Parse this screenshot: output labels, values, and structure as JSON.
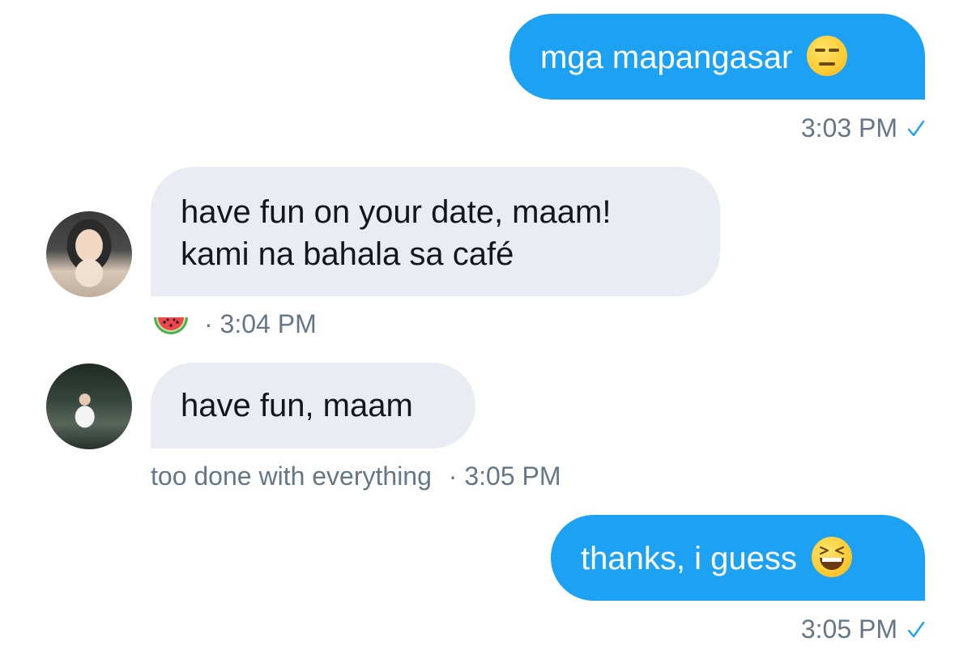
{
  "messages": [
    {
      "direction": "sent",
      "text": "mga mapangasar",
      "emoji": "expressionless-face-emoji",
      "time": "3:03 PM",
      "read_status": "check-icon"
    },
    {
      "direction": "received",
      "avatar": "avatar-person-peace-sign",
      "lines": [
        "have fun on your date, maam!",
        "kami na bahala sa café"
      ],
      "sender_emoji": "watermelon-emoji",
      "separator": "·",
      "time": "3:04 PM"
    },
    {
      "direction": "received",
      "avatar": "avatar-person-outdoors",
      "text": "have fun, maam",
      "sender_name": "too done with everything",
      "separator": "·",
      "time": "3:05 PM"
    },
    {
      "direction": "sent",
      "text": "thanks, i guess",
      "emoji": "grinning-squinting-face-emoji",
      "time": "3:05 PM",
      "read_status": "check-icon"
    }
  ],
  "colors": {
    "sent_bubble": "#1da1f2",
    "received_bubble": "#e9ecf2",
    "meta_text": "#657786",
    "check": "#1da1f2"
  }
}
